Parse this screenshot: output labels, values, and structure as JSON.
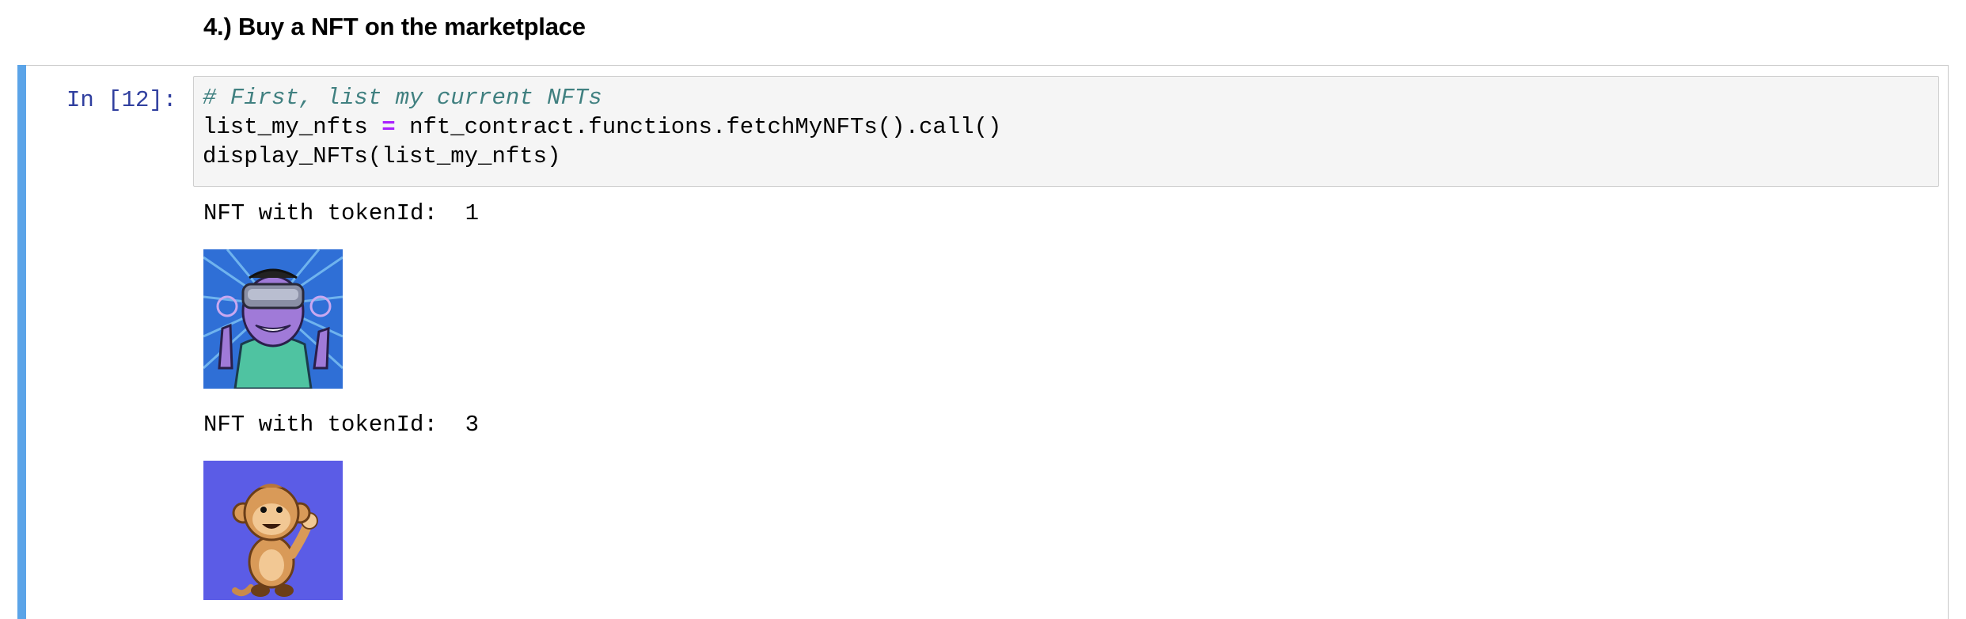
{
  "section_heading": "4.) Buy a NFT on the marketplace",
  "cell": {
    "prompt": "In [12]:",
    "code": {
      "comment": "# First, list my current NFTs",
      "line2_var": "list_my_nfts",
      "line2_op": "=",
      "line2_rest": "nft_contract.functions.fetchMyNFTs().call()",
      "line3": "display_NFTs(list_my_nfts)"
    },
    "outputs": [
      {
        "text": "NFT with tokenId:  1",
        "image": "vr-headset-character-image"
      },
      {
        "text": "NFT with tokenId:  3",
        "image": "waving-monkey-image"
      }
    ]
  },
  "colors": {
    "cell_bar": "#5ba4e8",
    "prompt": "#303f9f",
    "comment": "#408080",
    "operator": "#aa22ff",
    "monkey_bg": "#5b5ce6"
  }
}
